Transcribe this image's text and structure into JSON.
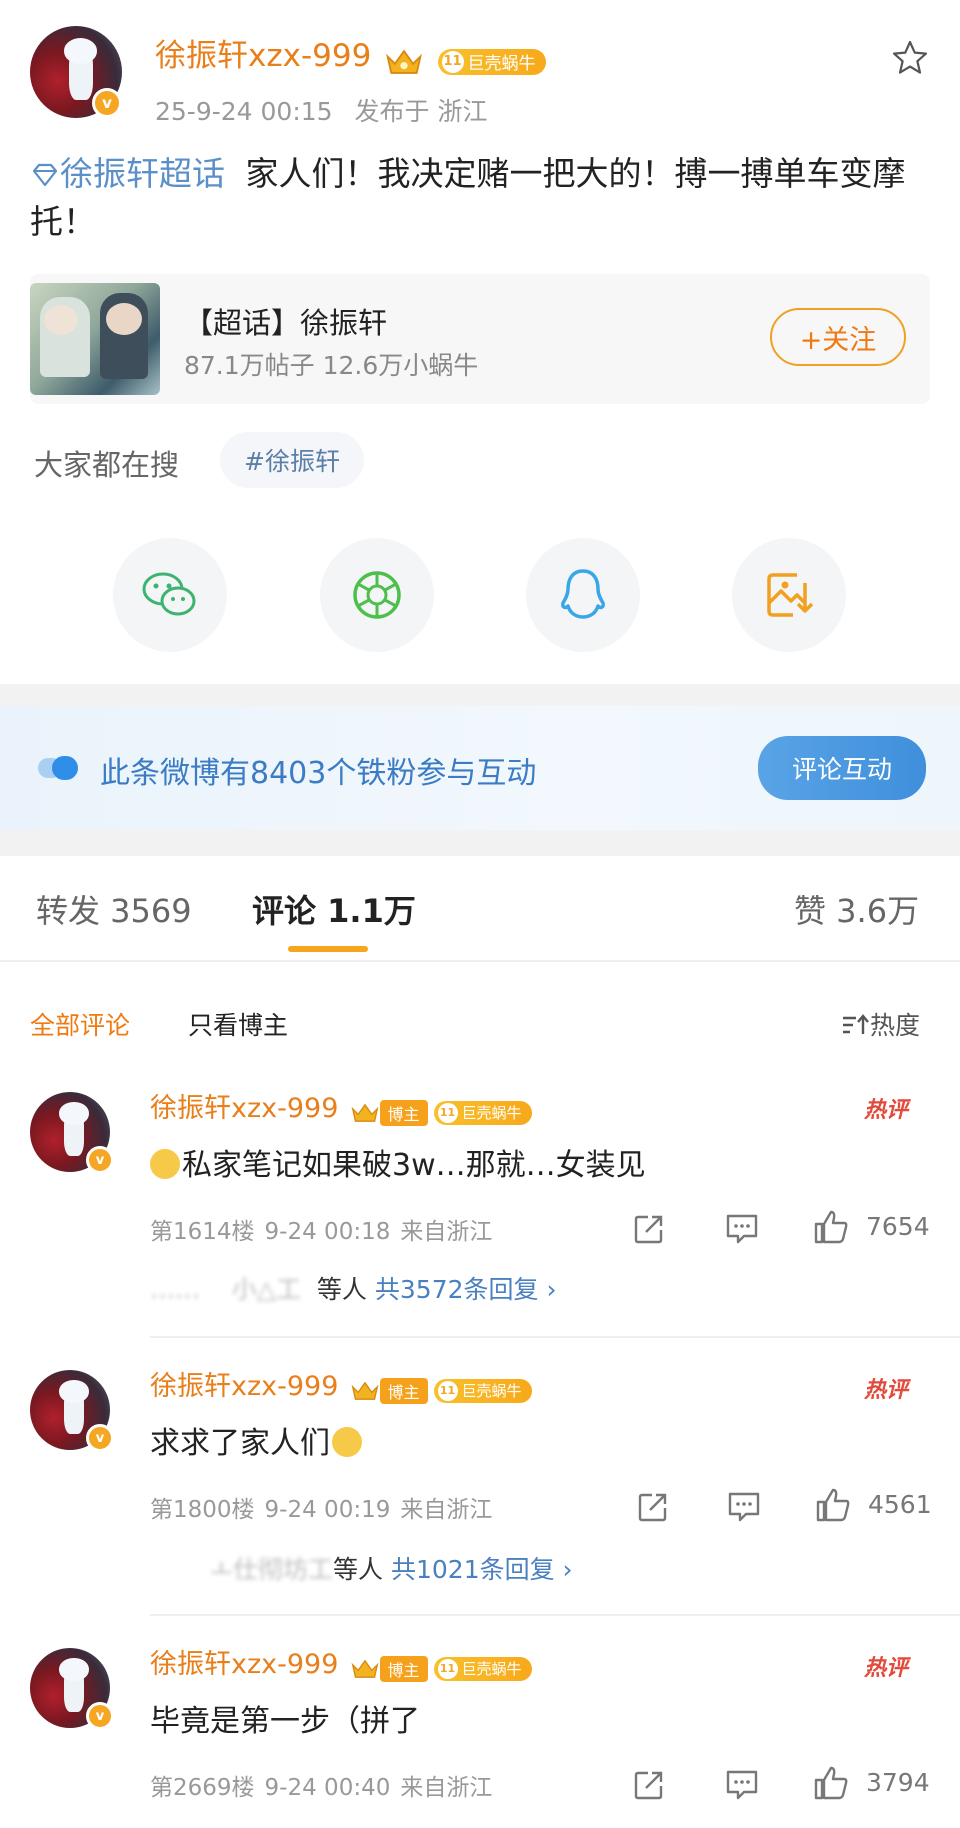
{
  "post": {
    "author": "徐振轩xzx-999",
    "level_badge_num": "11",
    "level_badge_text": "巨壳蜗牛",
    "timestamp": "25-9-24 00:15",
    "location": "发布于 浙江",
    "topic_link": "徐振轩超话",
    "body": "家人们！我决定赌一把大的！搏一搏单车变摩托！"
  },
  "topic_card": {
    "title": "【超话】徐振轩",
    "stats": "87.1万帖子 12.6万小蜗牛",
    "follow_label": "+关注"
  },
  "searching": {
    "label": "大家都在搜",
    "tag": "#徐振轩"
  },
  "share_icons": [
    "wechat-icon",
    "moments-icon",
    "qq-icon",
    "save-image-icon"
  ],
  "fans_banner": {
    "text": "此条微博有8403个铁粉参与互动",
    "button": "评论互动"
  },
  "tabs": {
    "repost": "转发 3569",
    "comment": "评论 1.1万",
    "like": "赞 3.6万"
  },
  "filters": {
    "all": "全部评论",
    "owner_only": "只看博主",
    "sort": "热度"
  },
  "comments": [
    {
      "author": "徐振轩xzx-999",
      "owner_badge": "博主",
      "level_num": "11",
      "level_text": "巨壳蜗牛",
      "hot": "热评",
      "text": "私家笔记如果破3w…那就…女装见",
      "floor": "第1614楼",
      "time": "9-24 00:18",
      "from": "来自浙江",
      "likes": "7654",
      "reply_prefix": "等人",
      "reply_count": "共3572条回复 ›"
    },
    {
      "author": "徐振轩xzx-999",
      "owner_badge": "博主",
      "level_num": "11",
      "level_text": "巨壳蜗牛",
      "hot": "热评",
      "text": "求求了家人们",
      "floor": "第1800楼",
      "time": "9-24 00:19",
      "from": "来自浙江",
      "likes": "4561",
      "reply_prefix": "等人",
      "reply_count": "共1021条回复 ›"
    },
    {
      "author": "徐振轩xzx-999",
      "owner_badge": "博主",
      "level_num": "11",
      "level_text": "巨壳蜗牛",
      "hot": "热评",
      "text": "毕竟是第一步（拼了",
      "floor": "第2669楼",
      "time": "9-24 00:40",
      "from": "来自浙江",
      "likes": "3794"
    }
  ]
}
